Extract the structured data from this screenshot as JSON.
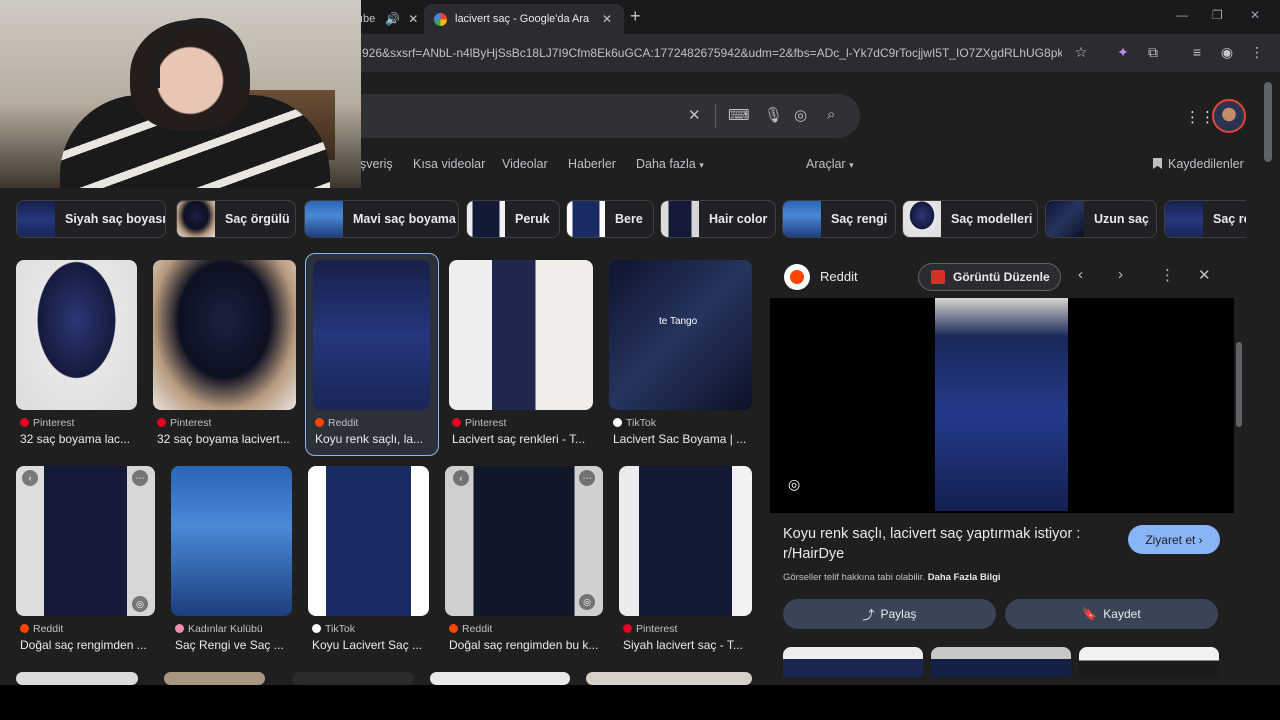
{
  "browser": {
    "prev_tab_label": "ıbe",
    "active_tab_title": "lacivert saç - Google'da Ara",
    "url": "926&sxsrf=ANbL-n4lByHjSsBc18LJ7I9Cfm8Ek6uGCA:1772482675942&udm=2&fbs=ADc_l-Yk7dC9rTocjjwI5T_IO7ZXgdRLhUG8pk-pM06..."
  },
  "nav": {
    "shopping_fragment": "şveriş",
    "short_videos": "Kısa videolar",
    "videos": "Videolar",
    "news": "Haberler",
    "more": "Daha fazla",
    "tools": "Araçlar",
    "saved": "Kaydedilenler"
  },
  "chips": [
    {
      "label": "Siyah saç boyası"
    },
    {
      "label": "Saç örgülü"
    },
    {
      "label": "Mavi saç boyama"
    },
    {
      "label": "Peruk"
    },
    {
      "label": "Bere"
    },
    {
      "label": "Hair color"
    },
    {
      "label": "Saç rengi"
    },
    {
      "label": "Saç modelleri"
    },
    {
      "label": "Uzun saç"
    },
    {
      "label": "Saç re"
    }
  ],
  "results": [
    {
      "source": "Pinterest",
      "title": "32 saç boyama lac..."
    },
    {
      "source": "Pinterest",
      "title": "32 saç boyama lacivert..."
    },
    {
      "source": "Reddit",
      "title": "Koyu renk saçlı, la..."
    },
    {
      "source": "Pinterest",
      "title": "Lacivert saç renkleri - T..."
    },
    {
      "source": "TikTok",
      "title": "Lacivert Sac Boyama | ...",
      "overlay_text": "te    Tango"
    },
    {
      "source": "Reddit",
      "title": "Doğal saç rengimden ..."
    },
    {
      "source": "Kadınlar Kulübü",
      "title": "Saç Rengi ve Saç ..."
    },
    {
      "source": "TikTok",
      "title": "Koyu Lacivert Saç ..."
    },
    {
      "source": "Reddit",
      "title": "Doğal saç rengimden bu k..."
    },
    {
      "source": "Pinterest",
      "title": "Siyah lacivert saç - T..."
    }
  ],
  "panel": {
    "source": "Reddit",
    "edit_button": "Görüntü Düzenle",
    "caption": "Koyu renk saçlı, lacivert saç yaptırmak istiyor : r/HairDye",
    "visit_button": "Ziyaret et",
    "copyright_note": "Görseller telif hakkına tabi olabilir.",
    "learn_more": "Daha Fazla Bilgi",
    "share_button": "Paylaş",
    "save_button": "Kaydet"
  },
  "colors": {
    "accent_blue": "#8ab4f8",
    "pinterest_red": "#e60023",
    "reddit_orange": "#ff4500",
    "background": "#1f1f1f"
  }
}
